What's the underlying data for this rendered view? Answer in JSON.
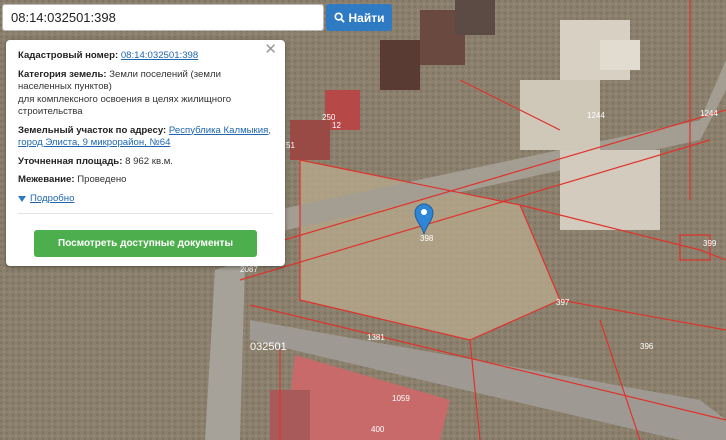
{
  "search": {
    "value": "08:14:032501:398"
  },
  "find_button": {
    "label": "Найти"
  },
  "popup": {
    "cadastral_label": "Кадастровый номер:",
    "cadastral_value": "08:14:032501:398",
    "category_label": "Категория земель:",
    "category_value": "Земли поселений (земли населенных пунктов)",
    "category_note": "для комплексного освоения в целях жилищного строительства",
    "address_label": "Земельный участок по адресу:",
    "address_value": "Республика Калмыкия, город Элиста, 9 микрорайон, №64",
    "area_label": "Уточненная площадь:",
    "area_value": "8 962 кв.м.",
    "survey_label": "Межевание:",
    "survey_value": "Проведено",
    "more_link": "Подробно",
    "docs_button": "Посмотреть доступные документы",
    "close_symbol": "✕"
  },
  "map": {
    "block_label": "032501",
    "parcel_labels": [
      "398",
      "397",
      "396",
      "399",
      "1244",
      "1244",
      "1381",
      "1059",
      "400",
      "250",
      "51",
      "2087",
      "12"
    ],
    "marker_color": "#2f86d6",
    "boundary_color": "#e0322c"
  }
}
